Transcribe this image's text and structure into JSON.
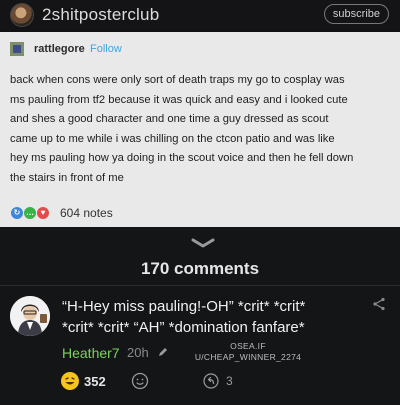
{
  "header": {
    "community_name": "2shitposterclub",
    "subscribe_label": "subscribe",
    "avatar_icon": "community-avatar-icon"
  },
  "post": {
    "blog_name": "rattlegore",
    "follow_label": "Follow",
    "body_lines": [
      "back when cons were only sort of death traps my go to cosplay was",
      "ms pauling from tf2 because it was quick and easy and i looked cute",
      "and shes a good character and one time a guy dressed as scout",
      "came up to me while i was chilling on the ctcon patio and was like",
      "hey ms pauling how ya doing in the scout voice and then he fell down",
      "the stairs in front of me"
    ],
    "notes": "604 notes",
    "note_icon_colors": [
      "#3e86d8",
      "#37b34a",
      "#e54b4b"
    ]
  },
  "thread": {
    "comments_count": "170 comments",
    "comment": {
      "text_line1": "“H-Hey miss pauling!-OH” *crit* *crit*",
      "text_line2": "*crit* *crit* “AH” *domination fanfare*",
      "author": "Heather7",
      "time": "20h",
      "flair_line1": "OSEA.IF",
      "flair_line2": "U/CHEAP_WINNER_2274",
      "reaction_count": "352",
      "reply_count": "3"
    }
  },
  "colors": {
    "background": "#111214",
    "post_background": "#e9e9ea",
    "author_green": "#7bd35a",
    "follow_blue": "#3aa7e0"
  }
}
